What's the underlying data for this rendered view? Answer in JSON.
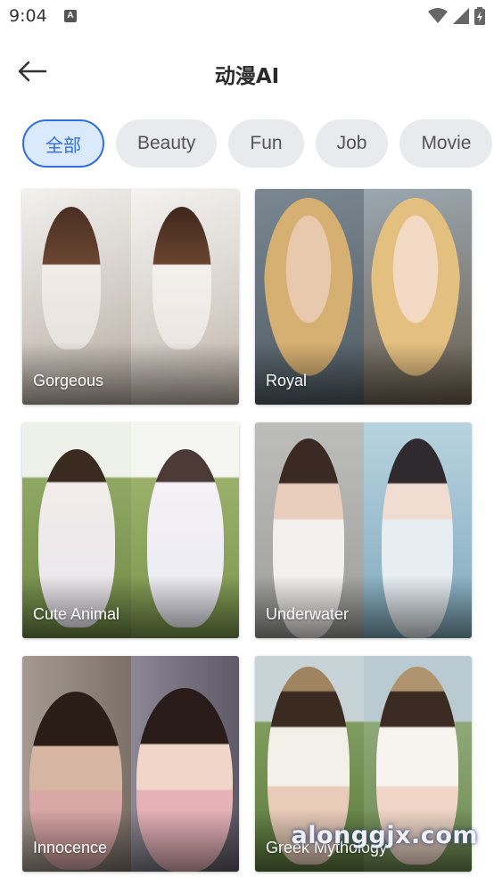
{
  "status_bar": {
    "time": "9:04",
    "icons": [
      "notification-a-icon",
      "wifi-icon",
      "signal-icon",
      "battery-charging-icon"
    ]
  },
  "header": {
    "title": "动漫AI",
    "back_icon": "back-arrow-icon"
  },
  "categories": {
    "items": [
      "全部",
      "Beauty",
      "Fun",
      "Job",
      "Movie"
    ],
    "selected": "全部",
    "accent_color": "#2f6fe0"
  },
  "styles": [
    {
      "label": "Gorgeous",
      "colors": [
        "#d9d9d6",
        "#e6e4e0"
      ]
    },
    {
      "label": "Royal",
      "colors": [
        "#5d6b74",
        "#8a7a60"
      ]
    },
    {
      "label": "Cute Animal",
      "colors": [
        "#7f9a57",
        "#8aa160"
      ]
    },
    {
      "label": "Underwater",
      "colors": [
        "#a9a9a9",
        "#8fb3c4"
      ]
    },
    {
      "label": "Innocence",
      "colors": [
        "#8a7f76",
        "#6e6a75"
      ]
    },
    {
      "label": "Greek Mythology",
      "colors": [
        "#7f9c5e",
        "#8ea6b0"
      ]
    }
  ],
  "watermark": "alonggjx.com"
}
